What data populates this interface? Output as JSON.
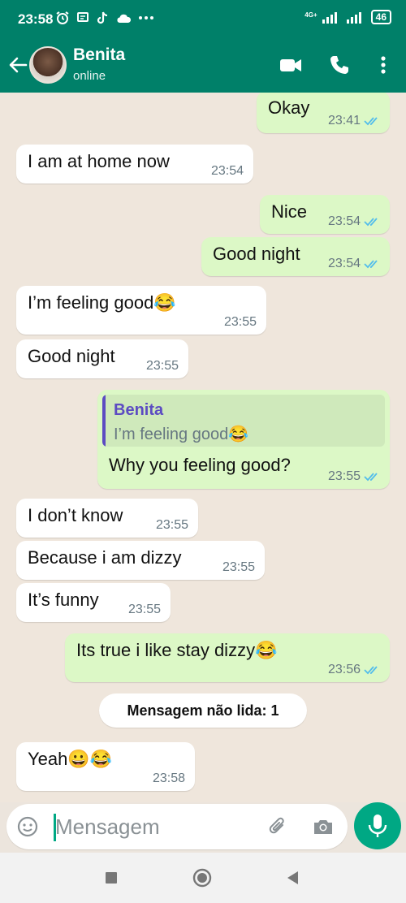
{
  "status_bar": {
    "time": "23:58",
    "net_label": "4G+",
    "battery": "46"
  },
  "header": {
    "contact_name": "Benita",
    "contact_status": "online"
  },
  "messages": [
    {
      "dir": "out",
      "text": "Okay",
      "time": "23:41",
      "read": true
    },
    {
      "dir": "in",
      "text": "I am at home now",
      "time": "23:54"
    },
    {
      "dir": "out",
      "text": "Nice",
      "time": "23:54",
      "read": true
    },
    {
      "dir": "out",
      "text": "Good night",
      "time": "23:54",
      "read": true
    },
    {
      "dir": "in",
      "text": "I’m feeling good😂",
      "time": "23:55"
    },
    {
      "dir": "in",
      "text": "Good night",
      "time": "23:55"
    },
    {
      "dir": "out",
      "text": "Why you feeling good?",
      "time": "23:55",
      "read": true,
      "quote": {
        "author": "Benita",
        "text": "I’m feeling good😂"
      }
    },
    {
      "dir": "in",
      "text": "I don’t know",
      "time": "23:55"
    },
    {
      "dir": "in",
      "text": "Because i am dizzy",
      "time": "23:55"
    },
    {
      "dir": "in",
      "text": "It’s funny",
      "time": "23:55"
    },
    {
      "dir": "out",
      "text": "Its true i like stay dizzy😂",
      "time": "23:56",
      "read": true
    },
    {
      "dir": "in",
      "text": "Yeah😀😂",
      "time": "23:58"
    }
  ],
  "unread_divider": "Mensagem não lida: 1",
  "composer": {
    "placeholder": "Mensagem"
  },
  "colors": {
    "header": "#008069",
    "accent": "#00a884",
    "outgoing": "#dcf8c6",
    "incoming": "#ffffff",
    "ticks": "#53bdeb",
    "quote_bar": "#5c4bc2"
  },
  "icons": [
    "back-arrow-icon",
    "video-call-icon",
    "phone-icon",
    "more-vert-icon",
    "emoji-icon",
    "attach-icon",
    "camera-icon",
    "mic-icon",
    "alarm-icon",
    "tiktok-icon",
    "cloud-icon",
    "nav-square-icon",
    "nav-home-icon",
    "nav-back-icon"
  ]
}
